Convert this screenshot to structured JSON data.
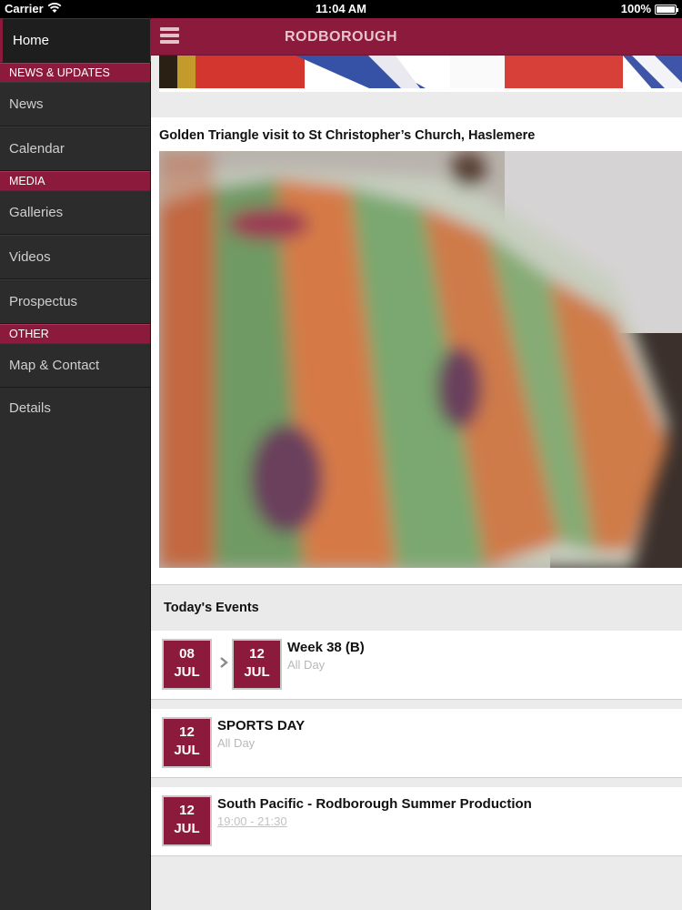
{
  "status_bar": {
    "carrier": "Carrier",
    "time": "11:04 AM",
    "battery": "100%"
  },
  "sidebar": {
    "items": [
      {
        "label": "Home",
        "active": true
      },
      {
        "header": "NEWS & UPDATES"
      },
      {
        "label": "News"
      },
      {
        "label": "Calendar"
      },
      {
        "header": "MEDIA"
      },
      {
        "label": "Galleries"
      },
      {
        "label": "Videos"
      },
      {
        "label": "Prospectus"
      },
      {
        "header": "OTHER"
      },
      {
        "label": "Map & Contact Details"
      }
    ]
  },
  "header": {
    "title": "RODBOROUGH",
    "menu_icon": "hamburger-menu-icon"
  },
  "story": {
    "title": "Golden Triangle visit to St Christopher’s Church, Haslemere"
  },
  "events": {
    "title": "Today's Events",
    "items": [
      {
        "start_day": "08",
        "start_month": "JUL",
        "end_day": "12",
        "end_month": "JUL",
        "title": "Week 38 (B)",
        "time": "All Day"
      },
      {
        "start_day": "12",
        "start_month": "JUL",
        "title": "SPORTS DAY",
        "time": "All Day"
      },
      {
        "start_day": "12",
        "start_month": "JUL",
        "title": "South Pacific - Rodborough Summer Production",
        "time": "19:00 - 21:30"
      }
    ]
  },
  "colors": {
    "brand": "#8c1a3c",
    "sidebar": "#2c2c2c",
    "content_bg": "#ebebeb"
  }
}
